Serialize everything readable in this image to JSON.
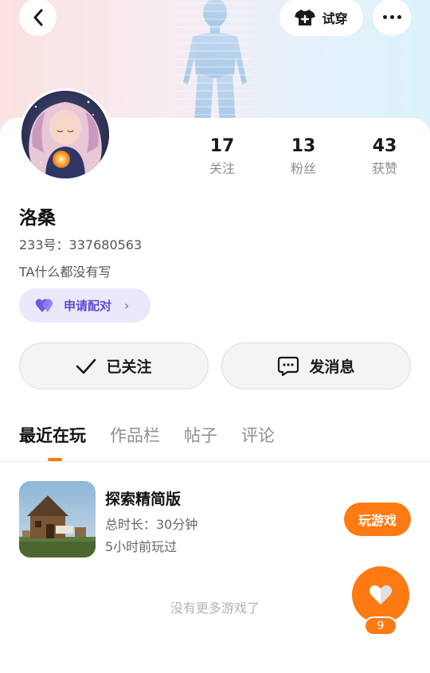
{
  "header": {
    "back_icon": "chevron-left-icon",
    "tryon_label": "试穿",
    "tryon_icon": "tshirt-icon",
    "more_icon": "more-dots-icon"
  },
  "profile": {
    "name": "洛桑",
    "uid": "233号：337680563",
    "bio": "TA什么都没有写",
    "pair_label": "申请配对",
    "stats": {
      "following": {
        "value": "17",
        "label": "关注"
      },
      "fans": {
        "value": "13",
        "label": "粉丝"
      },
      "likes": {
        "value": "43",
        "label": "获赞"
      }
    }
  },
  "actions": {
    "follow_label": "已关注",
    "message_label": "发消息"
  },
  "tabs": [
    "最近在玩",
    "作品栏",
    "帖子",
    "评论"
  ],
  "games": [
    {
      "title": "探索精简版",
      "duration": "总时长：30分钟",
      "last_played": "5小时前玩过",
      "play_label": "玩游戏"
    }
  ],
  "list_end": "没有更多游戏了",
  "like_fab": {
    "count": "9",
    "icon": "heart-icon"
  },
  "colors": {
    "accent": "#ff7a12",
    "pair": "#5a4fcf"
  }
}
